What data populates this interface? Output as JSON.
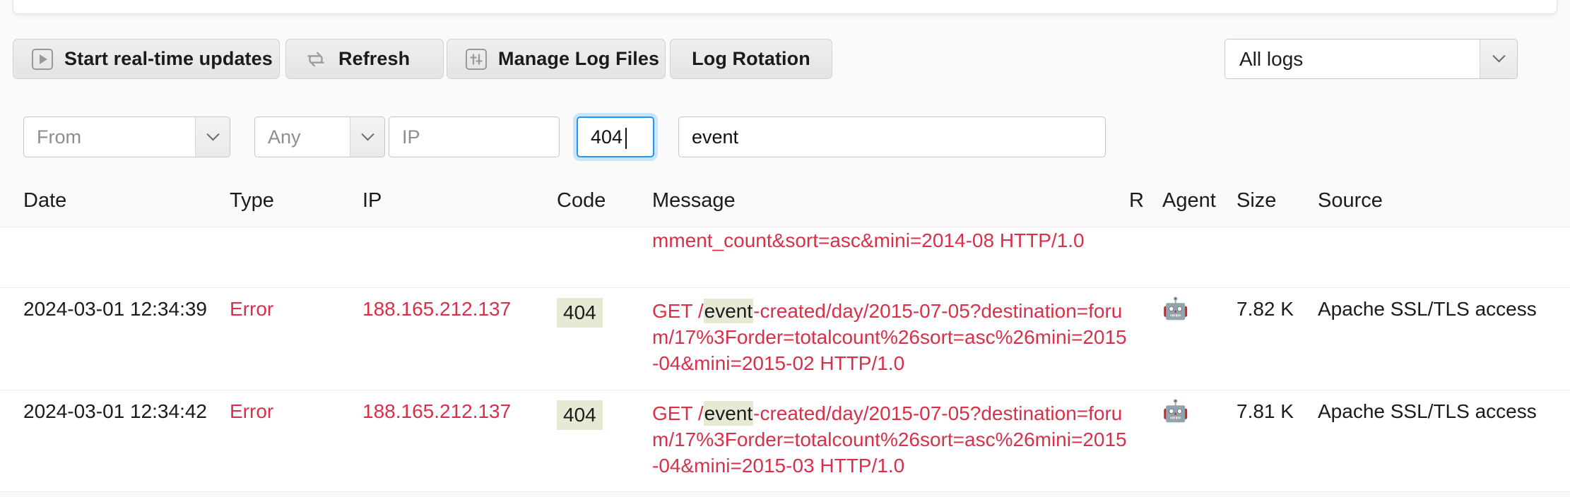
{
  "toolbar": {
    "buttons": [
      {
        "label": "Start real-time updates",
        "icon": "play-square-icon"
      },
      {
        "label": "Refresh",
        "icon": "refresh-arrows-icon"
      },
      {
        "label": "Manage Log Files",
        "icon": "sliders-square-icon"
      },
      {
        "label": "Log Rotation",
        "icon": ""
      }
    ],
    "log_source_select": {
      "value": "All logs",
      "caret_icon": "chevron-down-icon"
    }
  },
  "filters": {
    "date_from": {
      "placeholder": "From",
      "value": "",
      "caret_icon": "chevron-down-icon"
    },
    "type": {
      "value": "Any",
      "caret_icon": "chevron-down-icon"
    },
    "ip": {
      "placeholder": "IP",
      "value": ""
    },
    "code": {
      "value": "404",
      "focused": true
    },
    "search": {
      "value": "event",
      "placeholder": ""
    }
  },
  "table": {
    "columns": [
      "Date",
      "Type",
      "IP",
      "Code",
      "Message",
      "R",
      "Agent",
      "Size",
      "Source"
    ],
    "rows": [
      {
        "clipped": true,
        "date": "",
        "type": "",
        "ip": "",
        "code": "",
        "message_pre": "",
        "message_hl": "",
        "message_post": "mment_count&sort=asc&mini=2014-08 HTTP/1.0",
        "r": "",
        "agent": "",
        "size": "",
        "source": ""
      },
      {
        "clipped": false,
        "date": "2024-03-01 12:34:39",
        "type": "Error",
        "ip": "188.165.212.137",
        "code": "404",
        "message_pre": "GET /",
        "message_hl": "event",
        "message_post": "-created/day/2015-07-05?destination=forum/17%3Forder=totalcount%26sort=asc%26mini=2015-04&mini=2015-02 HTTP/1.0",
        "r": "",
        "agent": "robot-icon",
        "size": "7.82 K",
        "source": "Apache SSL/TLS access"
      },
      {
        "clipped": false,
        "date": "2024-03-01 12:34:42",
        "type": "Error",
        "ip": "188.165.212.137",
        "code": "404",
        "message_pre": "GET /",
        "message_hl": "event",
        "message_post": "-created/day/2015-07-05?destination=forum/17%3Forder=totalcount%26sort=asc%26mini=2015-04&mini=2015-03 HTTP/1.0",
        "r": "",
        "agent": "robot-icon",
        "size": "7.81 K",
        "source": "Apache SSL/TLS access"
      }
    ]
  },
  "colors": {
    "error_red": "#d9304a",
    "highlight_green": "#e4ead3",
    "focus_blue": "#2196f3",
    "page_bg": "#fafafa"
  }
}
